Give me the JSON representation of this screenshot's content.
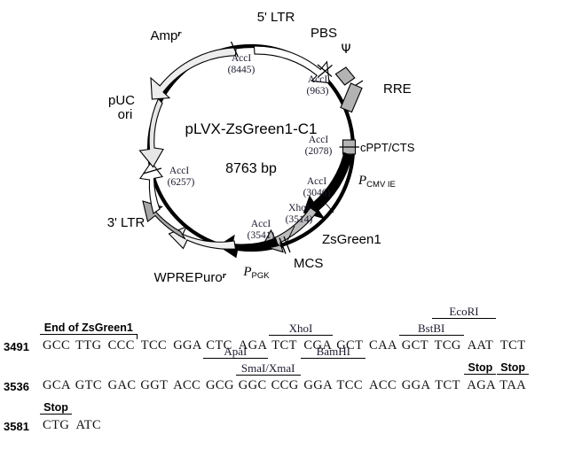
{
  "plasmid": {
    "name": "pLVX-ZsGreen1-C1",
    "size": "8763 bp",
    "features": [
      {
        "id": "amp",
        "label": "Ampʳ",
        "type": "arrow",
        "fill": "#ededed"
      },
      {
        "id": "five_ltr",
        "label": "5' LTR",
        "type": "arrow",
        "fill": "#ffffff"
      },
      {
        "id": "pbs",
        "label": "PBS",
        "type": "tick",
        "fill": "none"
      },
      {
        "id": "psi",
        "label": "Ψ",
        "type": "box",
        "fill": "#b3b3b3"
      },
      {
        "id": "rre",
        "label": "RRE",
        "type": "box",
        "fill": "#b3b3b3"
      },
      {
        "id": "cppt",
        "label": "cPPT/CTS",
        "type": "box",
        "fill": "#b3b3b3"
      },
      {
        "id": "pcmv",
        "label": "P",
        "sub": "CMV IE",
        "type": "arrow",
        "fill": "#000000"
      },
      {
        "id": "zsgreen",
        "label": "ZsGreen1",
        "type": "arrow",
        "fill": "#bdbdbd"
      },
      {
        "id": "mcs",
        "label": "MCS",
        "type": "tick",
        "fill": "none"
      },
      {
        "id": "ppgk",
        "label": "P",
        "sub": "PGK",
        "type": "arrow",
        "fill": "#000000"
      },
      {
        "id": "puro",
        "label": "Puroʳ",
        "type": "arrow",
        "fill": "#efefef"
      },
      {
        "id": "wpre",
        "label": "WPRE",
        "type": "arrow",
        "fill": "#a8a8a8"
      },
      {
        "id": "three_ltr",
        "label": "3' LTR",
        "type": "arrow",
        "fill": "#ffffff"
      },
      {
        "id": "puc",
        "label": "pUC\nori",
        "type": "arrow",
        "fill": "#e6e6e6"
      }
    ],
    "sites": [
      {
        "enzyme": "AccI",
        "position": "(8445)"
      },
      {
        "enzyme": "AccI",
        "position": "(963)"
      },
      {
        "enzyme": "AccI",
        "position": "(2078)"
      },
      {
        "enzyme": "AccI",
        "position": "(3046)"
      },
      {
        "enzyme": "XhoI",
        "position": "(3514)"
      },
      {
        "enzyme": "AccI",
        "position": "(3541)"
      },
      {
        "enzyme": "AccI",
        "position": "(6257)"
      }
    ],
    "labels": {
      "amp": "Ampʳ",
      "five_ltr": "5' LTR",
      "pbs": "PBS",
      "psi": "Ψ",
      "rre": "RRE",
      "cppt": "cPPT/CTS",
      "pcmv_main": "P",
      "pcmv_sub": "CMV IE",
      "zsgreen": "ZsGreen1",
      "mcs": "MCS",
      "ppgk_main": "P",
      "ppgk_sub": "PGK",
      "puro": "Puroʳ",
      "wpre": "WPRE",
      "three_ltr": "3' LTR",
      "puc_line1": "pUC",
      "puc_line2": "ori"
    },
    "site_labels": {
      "accI_8445_e": "AccI",
      "accI_8445_p": "(8445)",
      "accI_963_e": "AccI",
      "accI_963_p": "(963)",
      "accI_2078_e": "AccI",
      "accI_2078_p": "(2078)",
      "accI_3046_e": "AccI",
      "accI_3046_p": "(3046)",
      "xhoI_3514_e": "XhoI",
      "xhoI_3514_p": "(3514)",
      "accI_3541_e": "AccI",
      "accI_3541_p": "(3541)",
      "accI_6257_e": "AccI",
      "accI_6257_p": "(6257)"
    }
  },
  "sequence": {
    "rows": [
      {
        "number": "3491",
        "codons": [
          "GCC",
          "TTG",
          "CCC",
          "TCC",
          "GGA",
          "CTC",
          "AGA",
          "TCT",
          "CGA",
          "GCT",
          "CAA",
          "GCT",
          "TCG",
          "AAT",
          "TCT"
        ]
      },
      {
        "number": "3536",
        "codons": [
          "GCA",
          "GTC",
          "GAC",
          "GGT",
          "ACC",
          "GCG",
          "GGC",
          "CCG",
          "GGA",
          "TCC",
          "ACC",
          "GGA",
          "TCT",
          "AGA",
          "TAA"
        ]
      },
      {
        "number": "3581",
        "codons": [
          "CTG",
          "ATC"
        ]
      }
    ],
    "annotations": [
      {
        "id": "a1",
        "text": "End of ZsGreen1",
        "style": "sans",
        "row": 0,
        "tier": 0,
        "start": 0,
        "span": 3,
        "tickright": true
      },
      {
        "id": "a2",
        "text": "XhoI",
        "style": "serif",
        "row": 0,
        "tier": 0,
        "start": 7,
        "span": 2,
        "tickright": false
      },
      {
        "id": "a3",
        "text": "BstBI",
        "style": "serif",
        "row": 0,
        "tier": 0,
        "start": 11,
        "span": 2,
        "tickright": false
      },
      {
        "id": "a4",
        "text": "EcoRI",
        "style": "serif",
        "row": 0,
        "tier": 1,
        "start": 12,
        "span": 2,
        "tickright": false
      },
      {
        "id": "a5",
        "text": "ApaI",
        "style": "serif",
        "row": 1,
        "tier": 1,
        "start": 5,
        "span": 2,
        "tickright": false
      },
      {
        "id": "a6",
        "text": "SmaI/XmaI",
        "style": "serif",
        "row": 1,
        "tier": 0,
        "start": 6,
        "span": 2,
        "tickright": false
      },
      {
        "id": "a7",
        "text": "BamHI",
        "style": "serif",
        "row": 1,
        "tier": 1,
        "start": 8,
        "span": 2,
        "tickright": false
      },
      {
        "id": "a8",
        "text": "Stop",
        "style": "sans",
        "row": 1,
        "tier": 0,
        "start": 13,
        "span": 1,
        "tickright": false
      },
      {
        "id": "a9",
        "text": "Stop",
        "style": "sans",
        "row": 1,
        "tier": 0,
        "start": 14,
        "span": 1,
        "tickright": false
      },
      {
        "id": "a10",
        "text": "Stop",
        "style": "sans",
        "row": 2,
        "tier": 0,
        "start": 0,
        "span": 1,
        "tickright": false
      }
    ]
  }
}
